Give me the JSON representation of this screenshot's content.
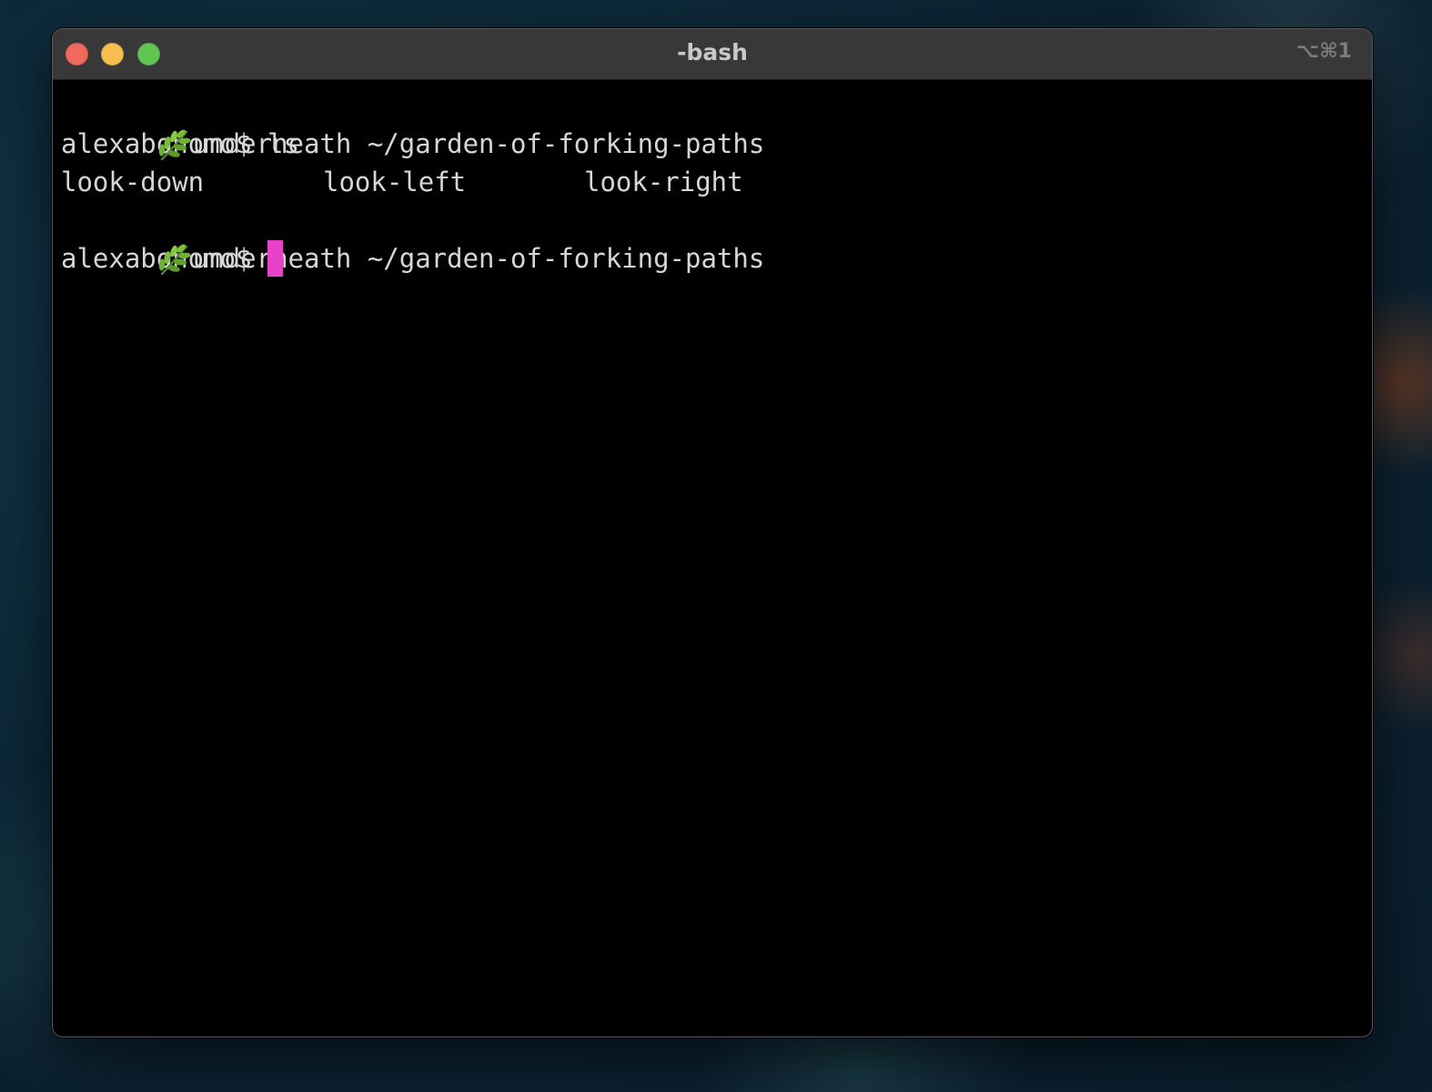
{
  "window": {
    "title": "-bash",
    "shortcut": "⌥⌘1",
    "controls": [
      "close",
      "minimize",
      "maximize"
    ]
  },
  "terminal": {
    "lines": [
      {
        "type": "prompt-info",
        "icon": "herb-leaf-icon",
        "text": "underneath ~/garden-of-forking-paths"
      },
      {
        "type": "prompt",
        "prompt": "alexabonomo$ ",
        "command": "ls"
      },
      {
        "type": "output",
        "items": [
          "look-down",
          "look-left",
          "look-right"
        ]
      },
      {
        "type": "prompt-info",
        "icon": "herb-leaf-icon",
        "text": "underneath ~/garden-of-forking-paths"
      },
      {
        "type": "prompt",
        "prompt": "alexabonomo$ ",
        "command": ""
      }
    ],
    "cursor_color": "#e843c8",
    "text_color": "#d6d6d6",
    "background": "#000000"
  }
}
